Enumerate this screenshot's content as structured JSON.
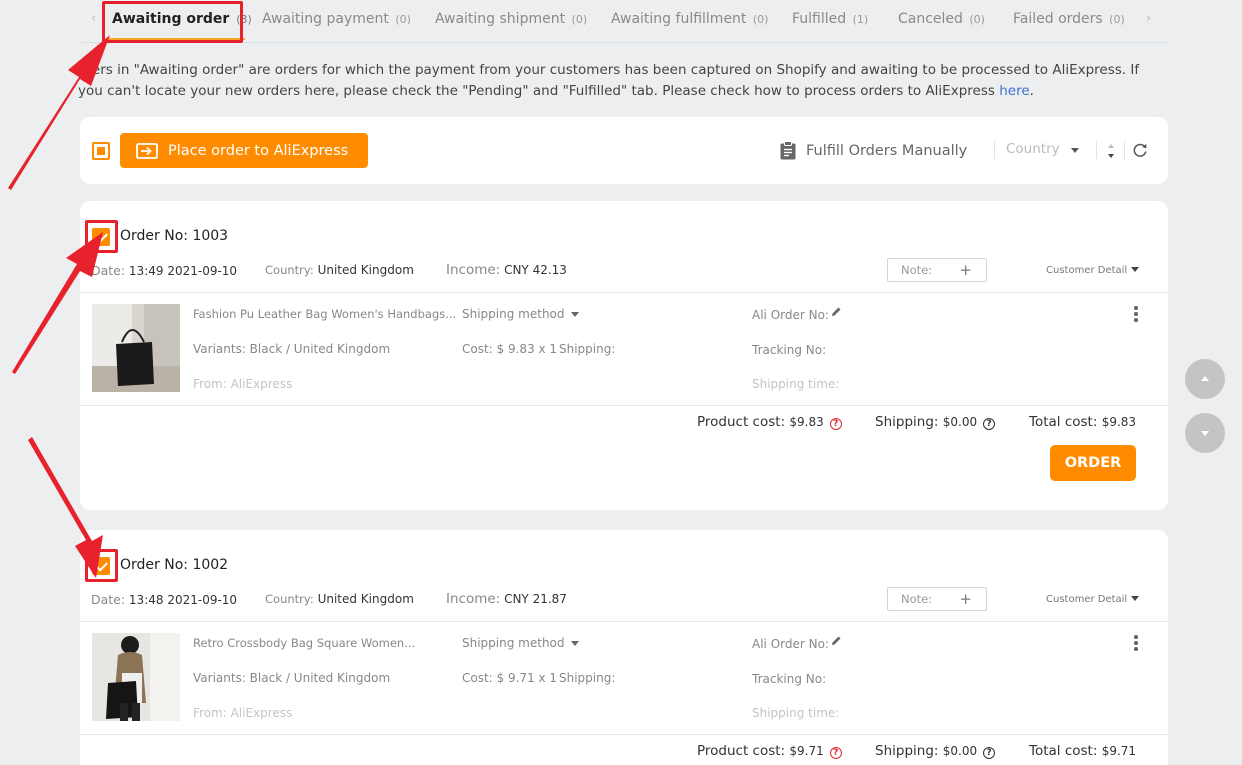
{
  "tabs": [
    {
      "label": "Awaiting order",
      "count": "(3)"
    },
    {
      "label": "Awaiting payment",
      "count": "(0)"
    },
    {
      "label": "Awaiting shipment",
      "count": "(0)"
    },
    {
      "label": "Awaiting fulfillment",
      "count": "(0)"
    },
    {
      "label": "Fulfilled",
      "count": "(1)"
    },
    {
      "label": "Canceled",
      "count": "(0)"
    },
    {
      "label": "Failed orders",
      "count": "(0)"
    }
  ],
  "info": {
    "text": "rders in \"Awaiting order\" are orders for which the payment from your customers has been captured on Shopify and awaiting to be processed to AliExpress. If you can't locate your new orders here, please check the \"Pending\" and \"Fulfilled\" tab. Please check how to process orders to AliExpress ",
    "link": "here",
    "end": "."
  },
  "toolbar": {
    "place_order_label": "Place order to AliExpress",
    "fulfill_manually_label": "Fulfill Orders Manually",
    "country_placeholder": "Country"
  },
  "labels": {
    "date": "Date:",
    "country": "Country:",
    "income": "Income:",
    "note": "Note:",
    "plus": "+",
    "customer_detail": "Customer Detail",
    "shipping_method": "Shipping method",
    "ali_order_no": "Ali Order No:",
    "tracking_no": "Tracking No:",
    "shipping_time": "Shipping time:",
    "shipping": "Shipping:",
    "product_cost": "Product cost:",
    "shipping_cost": "Shipping:",
    "total_cost": "Total cost:",
    "order_button": "ORDER"
  },
  "orders": [
    {
      "order_no": "Order No: 1003",
      "date": "13:49 2021-09-10",
      "country": "United Kingdom",
      "income": "CNY 42.13",
      "product_title": "Fashion Pu Leather Bag Women's Handbags...",
      "variants": "Variants: Black / United Kingdom",
      "from": "From: AliExpress",
      "cost": "Cost: $ 9.83 x 1",
      "product_cost": "$9.83",
      "shipping_cost": "$0.00",
      "total_cost": "$9.83"
    },
    {
      "order_no": "Order No: 1002",
      "date": "13:48 2021-09-10",
      "country": "United Kingdom",
      "income": "CNY 21.87",
      "product_title": "Retro Crossbody Bag Square Women...",
      "variants": "Variants: Black / United Kingdom",
      "from": "From: AliExpress",
      "cost": "Cost: $ 9.71 x 1",
      "product_cost": "$9.71",
      "shipping_cost": "$0.00",
      "total_cost": "$9.71"
    }
  ],
  "colors": {
    "accent": "#ff8c00",
    "annotation_red": "#e8222d",
    "link": "#3f6fd8",
    "background": "#eceef0"
  }
}
